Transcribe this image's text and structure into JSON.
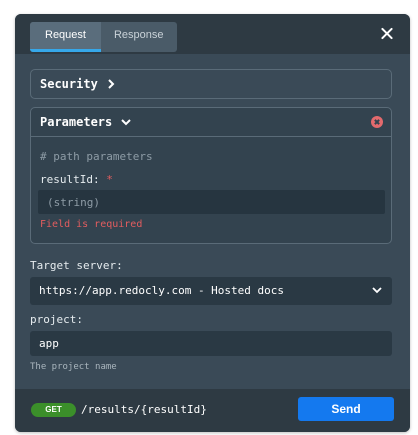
{
  "tabs": [
    {
      "label": "Request",
      "active": true
    },
    {
      "label": "Response",
      "active": false
    }
  ],
  "close_icon": "close-icon",
  "security": {
    "title": "Security",
    "icon": "chevron-right-icon"
  },
  "parameters": {
    "title": "Parameters",
    "icon": "chevron-down-icon",
    "clear_icon": "x-circle-icon",
    "comment": "# path parameters",
    "field_label": "resultId:",
    "required_mark": "*",
    "placeholder": "(string)",
    "error": "Field is required"
  },
  "server": {
    "label": "Target server:",
    "selected": "https://app.redocly.com - Hosted docs"
  },
  "project": {
    "label": "project:",
    "value": "app",
    "hint": "The project name"
  },
  "footer": {
    "method": "GET",
    "path": "/results/{resultId}",
    "send_label": "Send"
  },
  "colors": {
    "panel": "#3a4a57",
    "header": "#2e3a43",
    "accent": "#36a8ea",
    "error": "#e35d5f",
    "get": "#3b8f2a",
    "send": "#1479ef"
  }
}
